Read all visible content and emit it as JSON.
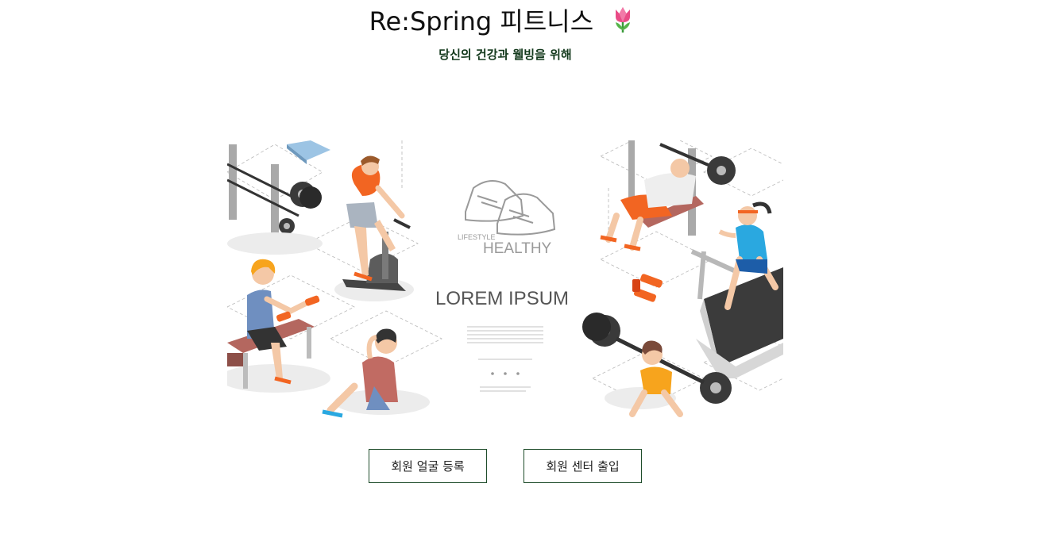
{
  "header": {
    "title": "Re:Spring 피트니스",
    "title_icon": "tulip-icon",
    "subtitle": "당신의 건강과 웰빙을 위해"
  },
  "hero": {
    "badge_small": "LIFESTYLE",
    "badge_big": "HEALTHY",
    "headline": "LOREM IPSUM"
  },
  "actions": {
    "register_label": "회원 얼굴 등록",
    "enter_label": "회원 센터 출입"
  },
  "colors": {
    "accent_border": "#1f4d2b",
    "subtitle": "#13391c",
    "orange": "#f26522",
    "blue": "#2aa8e0"
  }
}
